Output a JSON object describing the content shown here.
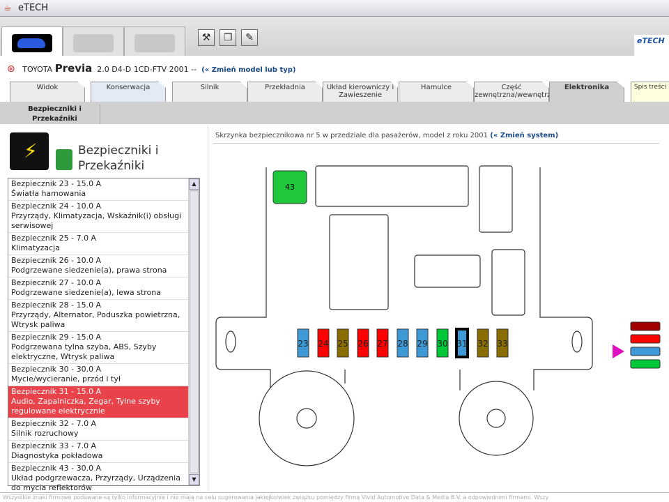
{
  "window": {
    "title": "eTECH"
  },
  "brand": {
    "logo_text": "eTECH"
  },
  "model": {
    "make": "TOYOTA",
    "model": "Previa",
    "type": "2.0 D4-D 1CD-FTV 2001 --",
    "change_link": "(« Zmień model lub typ)"
  },
  "tabs": [
    {
      "label": "Widok",
      "style": ""
    },
    {
      "label": "Konserwacja",
      "style": "light"
    },
    {
      "label": "Silnik",
      "style": ""
    },
    {
      "label": "Przekładnia",
      "style": ""
    },
    {
      "label": "Układ kierowniczy i Zawieszenie",
      "style": ""
    },
    {
      "label": "Hamulce",
      "style": ""
    },
    {
      "label": "Część zewnętrzna/wewnętrzna",
      "style": ""
    },
    {
      "label": "Elektronika",
      "style": "act"
    },
    {
      "label": "Spis treści",
      "style": "yel"
    }
  ],
  "subnav": {
    "item": "Bezpieczniki i Przekaźniki"
  },
  "section": {
    "title": "Bezpieczniki i Przekaźniki"
  },
  "fuse_list": [
    {
      "title": "Bezpiecznik 23 - 15.0 A",
      "desc": "Światła hamowania"
    },
    {
      "title": "Bezpiecznik 24 - 10.0 A",
      "desc": "Przyrządy, Klimatyzacja, Wskaźnik(i) obsługi serwisowej"
    },
    {
      "title": "Bezpiecznik 25 - 7.0 A",
      "desc": "Klimatyzacja"
    },
    {
      "title": "Bezpiecznik 26 - 10.0 A",
      "desc": "Podgrzewane siedzenie(a), prawa strona"
    },
    {
      "title": "Bezpiecznik 27 - 10.0 A",
      "desc": "Podgrzewane siedzenie(a), lewa strona"
    },
    {
      "title": "Bezpiecznik 28 - 15.0 A",
      "desc": "Przyrządy, Alternator, Poduszka powietrzna, Wtrysk paliwa"
    },
    {
      "title": "Bezpiecznik 29 - 15.0 A",
      "desc": "Podgrzewana tylna szyba, ABS, Szyby elektryczne, Wtrysk paliwa"
    },
    {
      "title": "Bezpiecznik 30 - 30.0 A",
      "desc": "Mycie/wycieranie, przód i tył"
    },
    {
      "title": "Bezpiecznik 31 - 15.0 A",
      "desc": "Audio, Zapalniczka, Zegar, Tylne szyby regulowane elektrycznie",
      "selected": true
    },
    {
      "title": "Bezpiecznik 32 - 7.0 A",
      "desc": "Silnik rozruchowy"
    },
    {
      "title": "Bezpiecznik 33 - 7.0 A",
      "desc": "Diagnostyka pokładowa"
    },
    {
      "title": "Bezpiecznik 43 - 30.0 A",
      "desc": "Układ podgrzewacza, Przyrządy, Urządzenia do mycia reflektorów"
    }
  ],
  "diagram": {
    "caption": "Skrzynka bezpiecznikowa nr 5 w przedziale dla pasażerów, model z roku 2001",
    "change_link": "(« Zmień system)",
    "fuses": [
      {
        "n": "23",
        "color": "#3d9ad6"
      },
      {
        "n": "24",
        "color": "#ff0000"
      },
      {
        "n": "25",
        "color": "#8a6d00"
      },
      {
        "n": "26",
        "color": "#ff0000"
      },
      {
        "n": "27",
        "color": "#ff0000"
      },
      {
        "n": "28",
        "color": "#3d9ad6"
      },
      {
        "n": "29",
        "color": "#3d9ad6"
      },
      {
        "n": "30",
        "color": "#00c838"
      },
      {
        "n": "31",
        "color": "#3d9ad6",
        "selected": true
      },
      {
        "n": "32",
        "color": "#8a6d00"
      },
      {
        "n": "33",
        "color": "#8a6d00"
      }
    ],
    "relay": {
      "n": "43",
      "color": "#1ec83a"
    },
    "legend_colors": [
      "#a00000",
      "#ff0000",
      "#3d9ad6",
      "#00c838"
    ],
    "legend_selected": 2,
    "pointer_color": "#e010c0"
  },
  "footer": {
    "text": "Wszystkie znaki firmowe podawane są tylko informacyjnie i nie mają na celu sugerowania jakiejkolwiek związku pomiędzy firmą Vivid Automotive Data & Media B.V. a odpowiednimi firmami. Wszy"
  }
}
